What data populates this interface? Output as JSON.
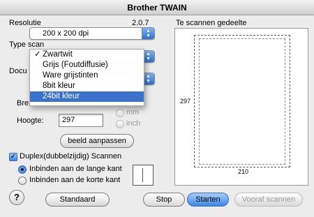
{
  "window": {
    "title": "Brother TWAIN"
  },
  "resolution": {
    "label": "Resolutie",
    "version": "2.0.7",
    "value": "200 x 200 dpi"
  },
  "scan_type": {
    "label": "Type scan",
    "menu": [
      {
        "label": "Zwartwit",
        "checked": true,
        "selected": false
      },
      {
        "label": "Grijs (Foutdiffusie)",
        "checked": false,
        "selected": false
      },
      {
        "label": "Ware grijstinten",
        "checked": false,
        "selected": false
      },
      {
        "label": "8bit kleur",
        "checked": false,
        "selected": false
      },
      {
        "label": "24bit kleur",
        "checked": false,
        "selected": true
      }
    ]
  },
  "document_label": "Docu",
  "width_label": "Bre",
  "height": {
    "label": "Hoogte:",
    "value": "297"
  },
  "units": {
    "mm": "mm",
    "inch": "inch"
  },
  "adjust_button": "beeld aanpassen",
  "duplex": {
    "label": "Duplex(dubbelzijdig) Scannen",
    "options": [
      "Inbinden aan de lange kant",
      "Inbinden aan de korte kant"
    ]
  },
  "preview": {
    "label": "Te scannen gedeelte",
    "height_ruler": "297",
    "width_ruler": "210"
  },
  "buttons": {
    "help": "?",
    "default": "Standaard",
    "stop": "Stop",
    "start": "Starten",
    "prescan": "Vooraf scannen"
  }
}
